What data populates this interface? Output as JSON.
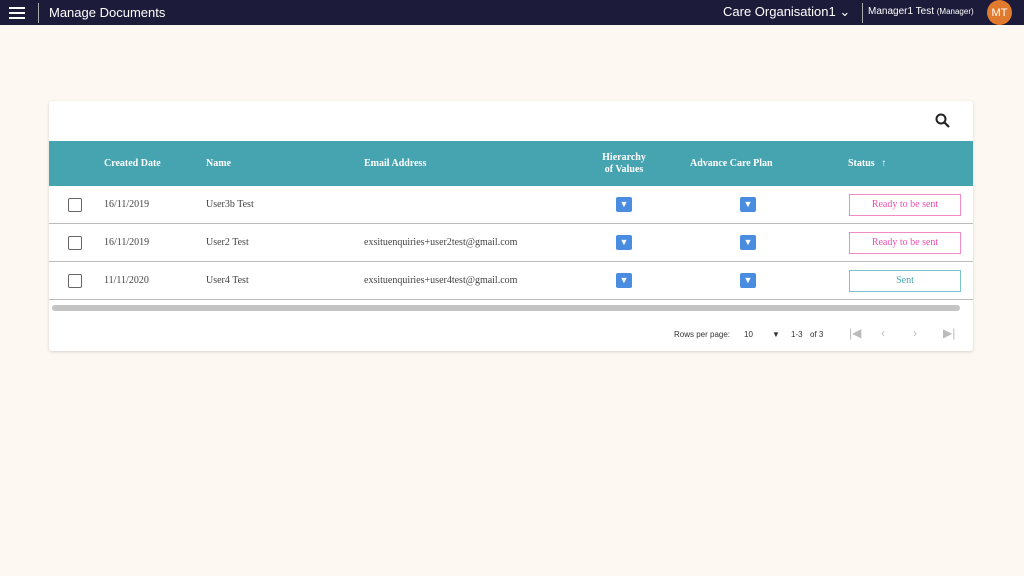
{
  "header": {
    "title": "Manage Documents",
    "organisation": "Care Organisation1",
    "user": "Manager1 Test",
    "role": "(Manager)",
    "initials": "MT"
  },
  "table": {
    "columns": [
      "Created Date",
      "Name",
      "Email Address",
      "Hierarchy of Values",
      "Advance Care Plan",
      "Status"
    ],
    "rows": [
      {
        "date": "16/11/2019",
        "name": "User3b Test",
        "email": "",
        "status": "Ready to be sent"
      },
      {
        "date": "16/11/2019",
        "name": "User2 Test",
        "email": "exsituenquiries+user2test@gmail.com",
        "status": "Ready to be sent"
      },
      {
        "date": "11/11/2020",
        "name": "User4 Test",
        "email": "exsituenquiries+user4test@gmail.com",
        "status": "Sent"
      }
    ]
  },
  "pagination": {
    "rows_label": "Rows per page:",
    "rows_value": "10",
    "range": "1-3",
    "of": "of 3"
  },
  "colors": {
    "header_bg": "#1c1b3a",
    "table_header": "#46a3b0",
    "pending": "#e94fb0",
    "sent": "#46a3b0"
  }
}
